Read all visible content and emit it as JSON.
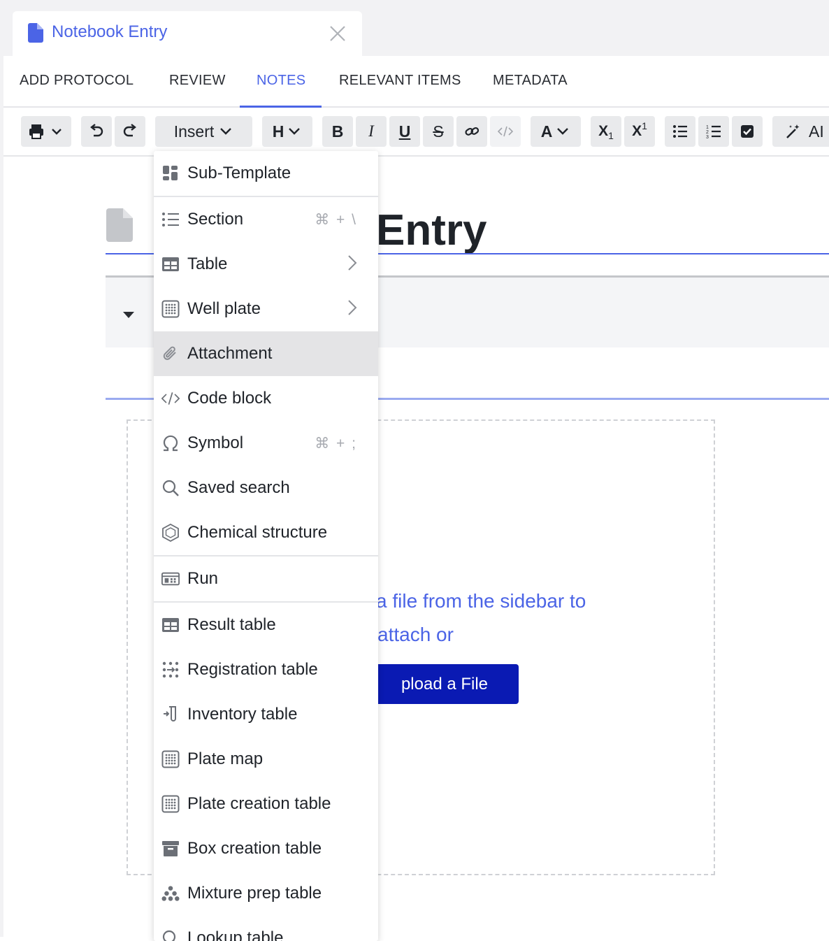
{
  "window_tab": {
    "title": "Notebook Entry",
    "close_icon": "close-icon"
  },
  "subnav": {
    "tabs": [
      "ADD PROTOCOL",
      "REVIEW",
      "NOTES",
      "RELEVANT ITEMS",
      "METADATA"
    ],
    "active": "NOTES"
  },
  "toolbar": {
    "insert_label": "Insert",
    "heading_label": "H",
    "bold_label": "B",
    "italic_label": "I",
    "underline_label": "U",
    "strike_label": "S",
    "text_color_label": "A",
    "subscript_label": "X",
    "subscript_mark": "1",
    "superscript_label": "X",
    "superscript_mark": "1",
    "ai_label": "AI"
  },
  "document": {
    "title_visible": "Entry",
    "dropzone_line1": "a file from the sidebar to",
    "dropzone_line2": "attach or",
    "upload_button": "pload a File"
  },
  "insert_menu": {
    "items": [
      {
        "label": "Sub-Template",
        "icon": "subtemplate-icon",
        "shortcut": ""
      },
      {
        "label": "Section",
        "icon": "list-icon",
        "shortcut": "⌘ + \\"
      },
      {
        "label": "Table",
        "icon": "table-icon",
        "submenu": true
      },
      {
        "label": "Well plate",
        "icon": "well-plate-icon",
        "submenu": true
      },
      {
        "label": "Attachment",
        "icon": "paperclip-icon",
        "highlighted": true
      },
      {
        "label": "Code block",
        "icon": "code-icon"
      },
      {
        "label": "Symbol",
        "icon": "omega-icon",
        "shortcut": "⌘ + ;"
      },
      {
        "label": "Saved search",
        "icon": "search-icon"
      },
      {
        "label": "Chemical structure",
        "icon": "hexagon-icon"
      },
      {
        "label": "Run",
        "icon": "run-icon"
      },
      {
        "label": "Result table",
        "icon": "table-icon"
      },
      {
        "label": "Registration table",
        "icon": "registration-icon"
      },
      {
        "label": "Inventory table",
        "icon": "inventory-icon"
      },
      {
        "label": "Plate map",
        "icon": "well-plate-icon"
      },
      {
        "label": "Plate creation table",
        "icon": "well-plate-icon"
      },
      {
        "label": "Box creation table",
        "icon": "box-icon"
      },
      {
        "label": "Mixture prep table",
        "icon": "mixture-icon"
      },
      {
        "label": "Lookup table",
        "icon": "search-icon"
      }
    ]
  },
  "colors": {
    "accent": "#4b64e6",
    "upload_button": "#0a1ab3",
    "highlight": "#e4e4e6"
  }
}
